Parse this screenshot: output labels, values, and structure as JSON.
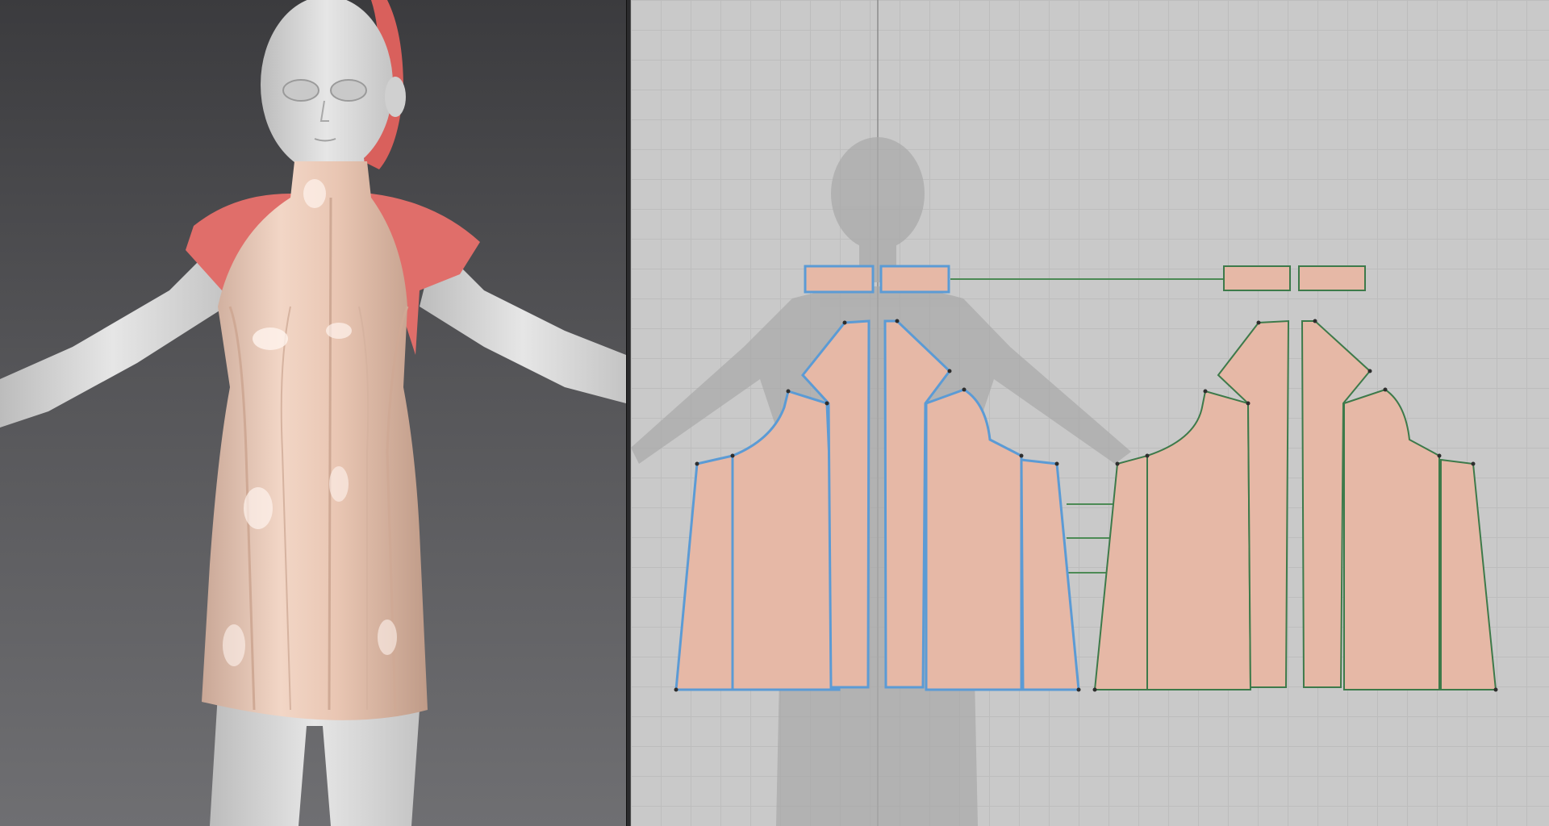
{
  "viewport_3d": {
    "avatar": "female-avatar",
    "garment": "halter-neck-mini-dress",
    "fabric_color": "#e8c2ad",
    "highlight_color": "#ff6e6e",
    "skin_color": "#d9d9d9"
  },
  "viewport_2d": {
    "grid": true,
    "avatar_silhouette": true,
    "pattern_fill_color": "#e6b8a6",
    "selected_outline_color": "#5b9bd5",
    "unselected_outline_color": "#3d7a4a",
    "pattern_groups": [
      "front-panels",
      "back-panels"
    ]
  }
}
